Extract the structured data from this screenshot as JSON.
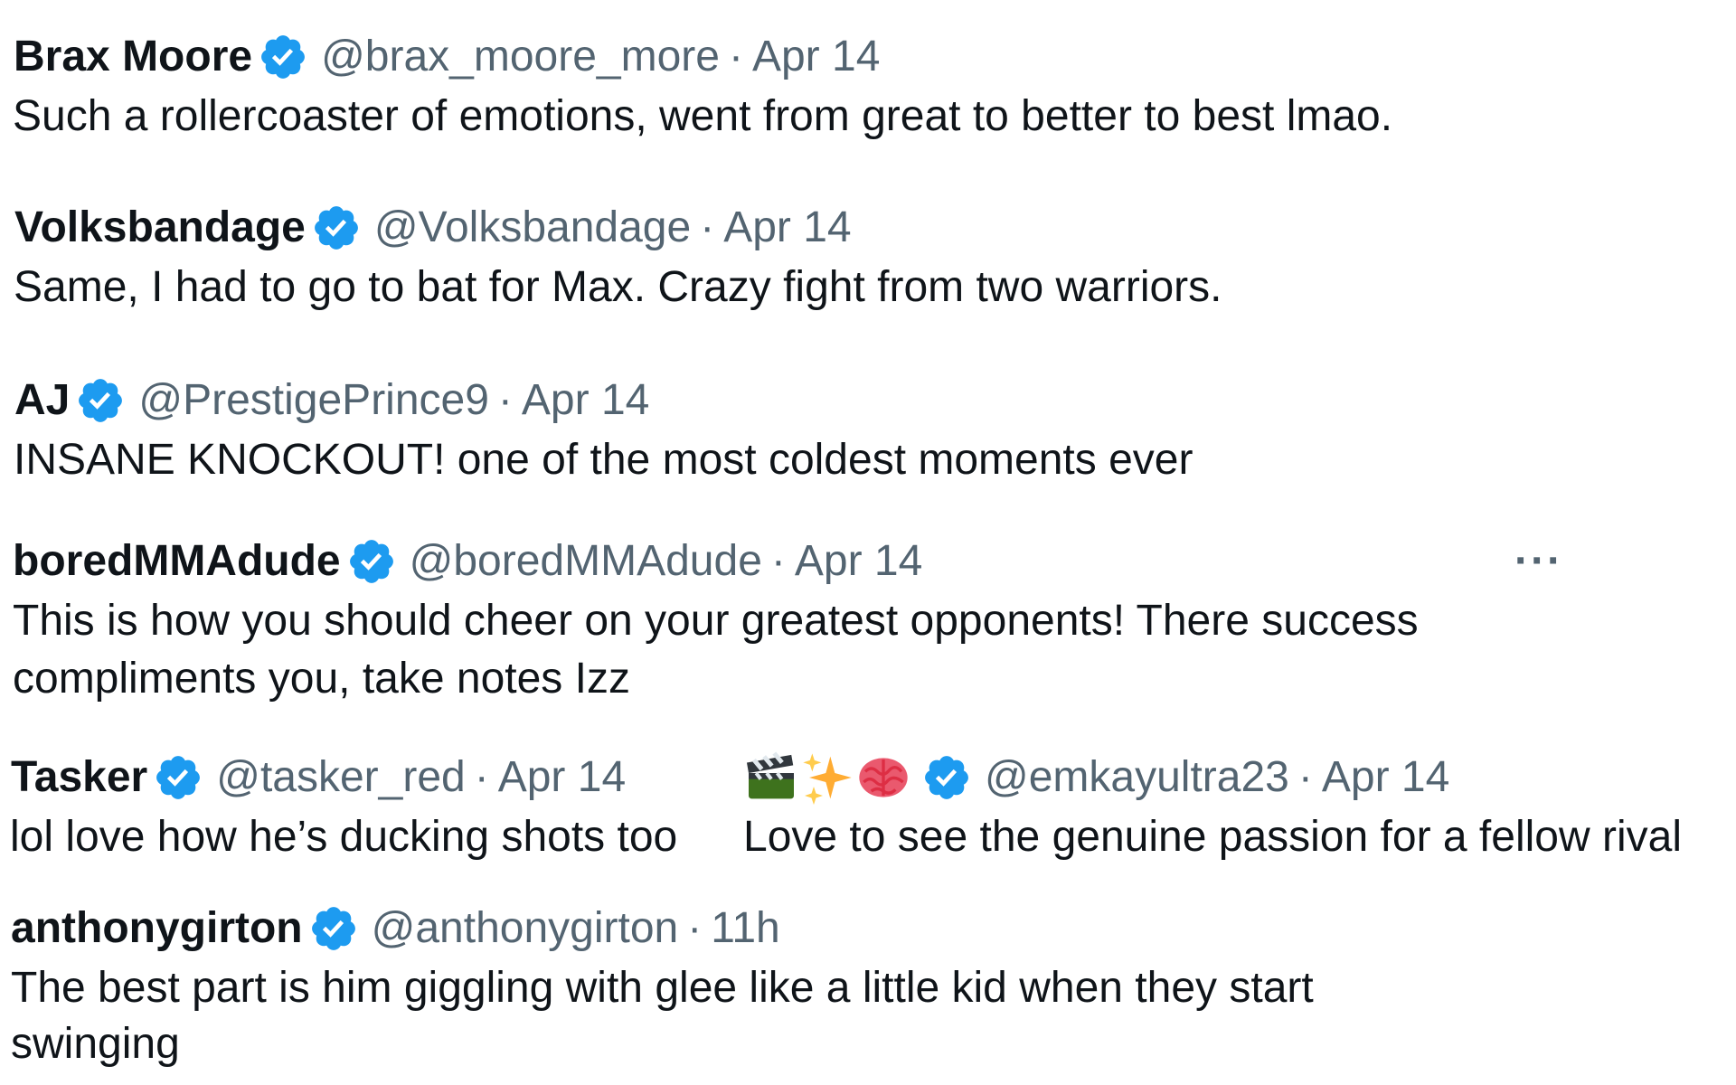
{
  "colors": {
    "verified_blue": "#1d9bf0",
    "text_primary": "#0f1419",
    "text_secondary": "#536471"
  },
  "replies": [
    {
      "name": "Brax Moore",
      "handle": "@brax_moore_more",
      "separator": "·",
      "time": "Apr 14",
      "verified": true,
      "text": "Such a rollercoaster of emotions, went from great to better to best lmao."
    },
    {
      "name": "Volksbandage",
      "handle": "@Volksbandage",
      "separator": "·",
      "time": "Apr 14",
      "verified": true,
      "text": "Same, I had to go to bat for Max. Crazy fight from two warriors."
    },
    {
      "name": "AJ",
      "handle": "@PrestigePrince9",
      "separator": "·",
      "time": "Apr 14",
      "verified": true,
      "text": "INSANE KNOCKOUT! one of the most coldest moments ever"
    },
    {
      "name": "boredMMAdude",
      "handle": "@boredMMAdude",
      "separator": "·",
      "time": "Apr 14",
      "verified": true,
      "more_label": "···",
      "text_line1": "This is how you should cheer on your greatest opponents! There success",
      "text_line2": "compliments you, take notes Izz"
    },
    {
      "name": "Tasker",
      "handle": "@tasker_red",
      "separator": "·",
      "time": "Apr 14",
      "verified": true,
      "text": "lol love how he’s ducking shots too"
    },
    {
      "name_icons": [
        "clapper-board-emoji",
        "sparkles-emoji",
        "brain-emoji"
      ],
      "handle": "@emkayultra23",
      "separator": "·",
      "time": "Apr 14",
      "verified": true,
      "text": "Love to see the genuine passion for a fellow rival"
    },
    {
      "name": "anthonygirton",
      "handle": "@anthonygirton",
      "separator": "·",
      "time": "11h",
      "verified": true,
      "text_line1": "The best part is him giggling with glee like a little kid when they start",
      "text_line2": "swinging"
    }
  ]
}
